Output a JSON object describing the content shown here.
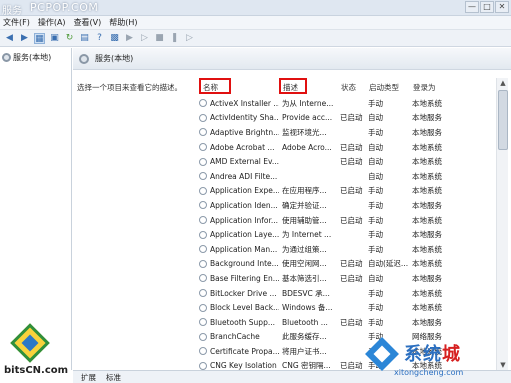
{
  "window": {
    "title": "服务",
    "watermark": "PCPOP.COM",
    "controls": [
      "—",
      "□",
      "✕"
    ]
  },
  "menu": [
    "文件(F)",
    "操作(A)",
    "查看(V)",
    "帮助(H)"
  ],
  "left_pane": {
    "tree_item": "服务(本地)"
  },
  "right_pane": {
    "header": "服务(本地)",
    "hint": "选择一个项目来查看它的描述。"
  },
  "table": {
    "columns": {
      "name": "名称",
      "desc": "描述",
      "status": "状态",
      "start": "启动类型",
      "logon": "登录为"
    },
    "rows": [
      {
        "name": "ActiveX Installer ...",
        "desc": "为从 Interne...",
        "status": "",
        "start": "手动",
        "logon": "本地系统"
      },
      {
        "name": "ActivIdentity Sha...",
        "desc": "Provide acc...",
        "status": "已启动",
        "start": "自动",
        "logon": "本地服务"
      },
      {
        "name": "Adaptive Brightn...",
        "desc": "监视环境光...",
        "status": "",
        "start": "手动",
        "logon": "本地服务"
      },
      {
        "name": "Adobe Acrobat ...",
        "desc": "Adobe Acro...",
        "status": "已启动",
        "start": "自动",
        "logon": "本地系统"
      },
      {
        "name": "AMD External Ev...",
        "desc": "",
        "status": "已启动",
        "start": "自动",
        "logon": "本地系统"
      },
      {
        "name": "Andrea ADI Filte...",
        "desc": "",
        "status": "",
        "start": "自动",
        "logon": "本地系统"
      },
      {
        "name": "Application Expe...",
        "desc": "在应用程序...",
        "status": "已启动",
        "start": "手动",
        "logon": "本地系统"
      },
      {
        "name": "Application Iden...",
        "desc": "确定并验证...",
        "status": "",
        "start": "手动",
        "logon": "本地服务"
      },
      {
        "name": "Application Infor...",
        "desc": "使用辅助管...",
        "status": "已启动",
        "start": "手动",
        "logon": "本地系统"
      },
      {
        "name": "Application Laye...",
        "desc": "为 Internet ...",
        "status": "",
        "start": "手动",
        "logon": "本地服务"
      },
      {
        "name": "Application Man...",
        "desc": "为通过组策...",
        "status": "",
        "start": "手动",
        "logon": "本地系统"
      },
      {
        "name": "Background Inte...",
        "desc": "使用空闲网...",
        "status": "已启动",
        "start": "自动(延迟...",
        "logon": "本地系统"
      },
      {
        "name": "Base Filtering En...",
        "desc": "基本筛选引...",
        "status": "已启动",
        "start": "自动",
        "logon": "本地服务"
      },
      {
        "name": "BitLocker Drive ...",
        "desc": "BDESVC 承...",
        "status": "",
        "start": "手动",
        "logon": "本地系统"
      },
      {
        "name": "Block Level Back...",
        "desc": "Windows 备...",
        "status": "",
        "start": "手动",
        "logon": "本地系统"
      },
      {
        "name": "Bluetooth Supp...",
        "desc": "Bluetooth ...",
        "status": "已启动",
        "start": "手动",
        "logon": "本地服务"
      },
      {
        "name": "BranchCache",
        "desc": "此服务缓存...",
        "status": "",
        "start": "手动",
        "logon": "网络服务"
      },
      {
        "name": "Certificate Propa...",
        "desc": "将用户证书...",
        "status": "",
        "start": "手动",
        "logon": "本地系统"
      },
      {
        "name": "CNG Key Isolation",
        "desc": "CNG 密钥隔...",
        "status": "已启动",
        "start": "手动",
        "logon": "本地系统"
      }
    ]
  },
  "tabs": [
    "扩展",
    "标准"
  ],
  "logos": {
    "bits": "bitsCN.com",
    "xitong_cn_a": "系统",
    "xitong_cn_b": "城",
    "xitong_en": "xitongcheng.com"
  }
}
